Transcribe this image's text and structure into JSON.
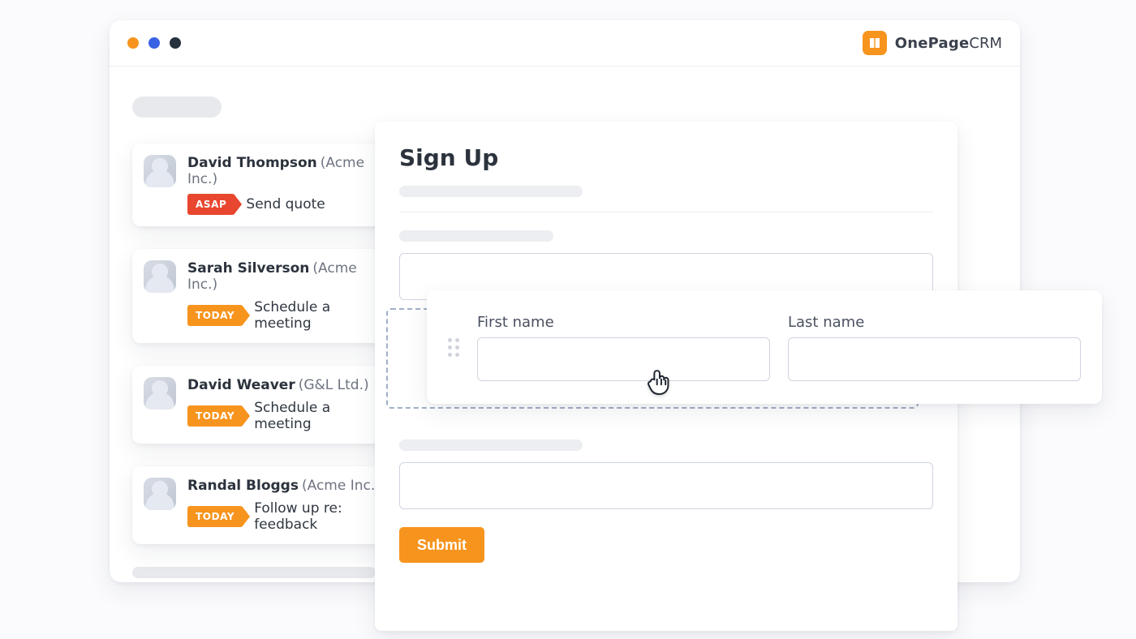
{
  "brand": {
    "name_strong": "OnePage",
    "name_light": "CRM"
  },
  "sidebar": {
    "contacts": [
      {
        "name": "David Thompson",
        "company": "(Acme Inc.)",
        "tag": "ASAP",
        "tag_color": "red",
        "task": "Send quote"
      },
      {
        "name": "Sarah Silverson",
        "company": "(Acme Inc.)",
        "tag": "TODAY",
        "tag_color": "orange",
        "task": "Schedule a meeting"
      },
      {
        "name": "David Weaver",
        "company": "(G&L Ltd.)",
        "tag": "TODAY",
        "tag_color": "orange",
        "task": "Schedule a meeting"
      },
      {
        "name": "Randal Bloggs",
        "company": "(Acme Inc.)",
        "tag": "TODAY",
        "tag_color": "orange",
        "task": "Follow up re: feedback"
      }
    ]
  },
  "form": {
    "title": "Sign Up",
    "fields": {
      "first_name_label": "First name",
      "last_name_label": "Last name"
    },
    "submit_label": "Submit"
  }
}
